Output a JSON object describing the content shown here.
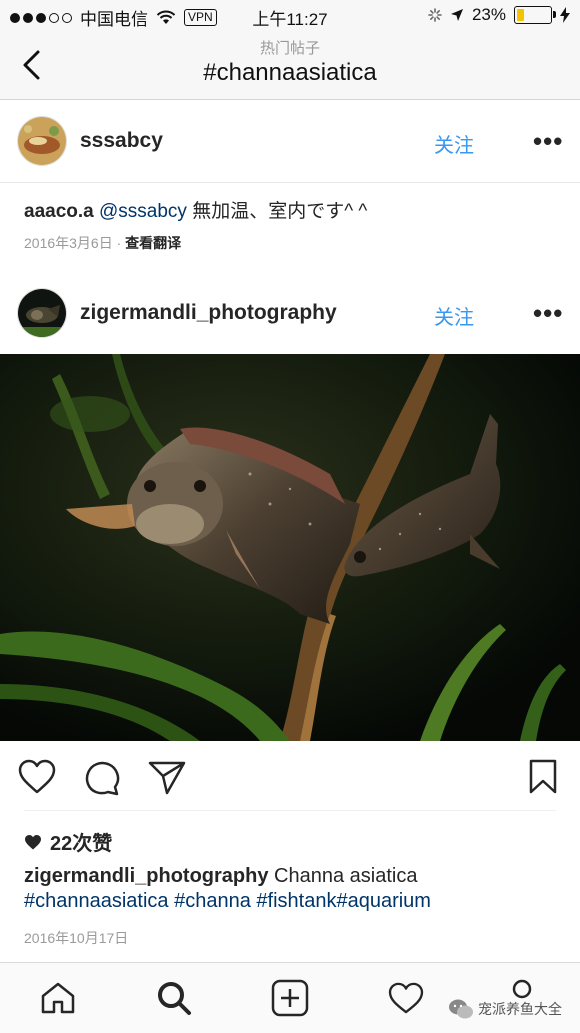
{
  "status_bar": {
    "carrier": "中国电信",
    "vpn": "VPN",
    "time": "上午11:27",
    "battery": "23%",
    "battery_level": 0.23,
    "battery_color": "#f5c400"
  },
  "nav": {
    "subtitle": "热门帖子",
    "title": "#channaasiatica"
  },
  "post_1": {
    "username": "sssabcy",
    "follow_label": "关注",
    "more_label": "•••",
    "comment": {
      "user": "aaaco.a",
      "mention": "@sssabcy",
      "text": " 無加温、室内です^ ^"
    },
    "date": "2016年3月6日",
    "separator": " · ",
    "translate_label": "查看翻译"
  },
  "post_2": {
    "username": "zigermandli_photography",
    "follow_label": "关注",
    "more_label": "•••",
    "likes": "22次赞",
    "caption": {
      "user": "zigermandli_photography",
      "text": " Channa asiatica",
      "tags": "#channaasiatica #channa #fishtank#aquarium"
    },
    "date": "2016年10月17日"
  },
  "watermark": "宠派养鱼大全",
  "colors": {
    "accent": "#3897f0",
    "link": "#003569"
  },
  "icons": [
    "back-chevron-icon",
    "heart-icon",
    "comment-icon",
    "share-icon",
    "bookmark-icon",
    "home-icon",
    "search-icon",
    "add-icon",
    "activity-icon",
    "profile-icon"
  ]
}
